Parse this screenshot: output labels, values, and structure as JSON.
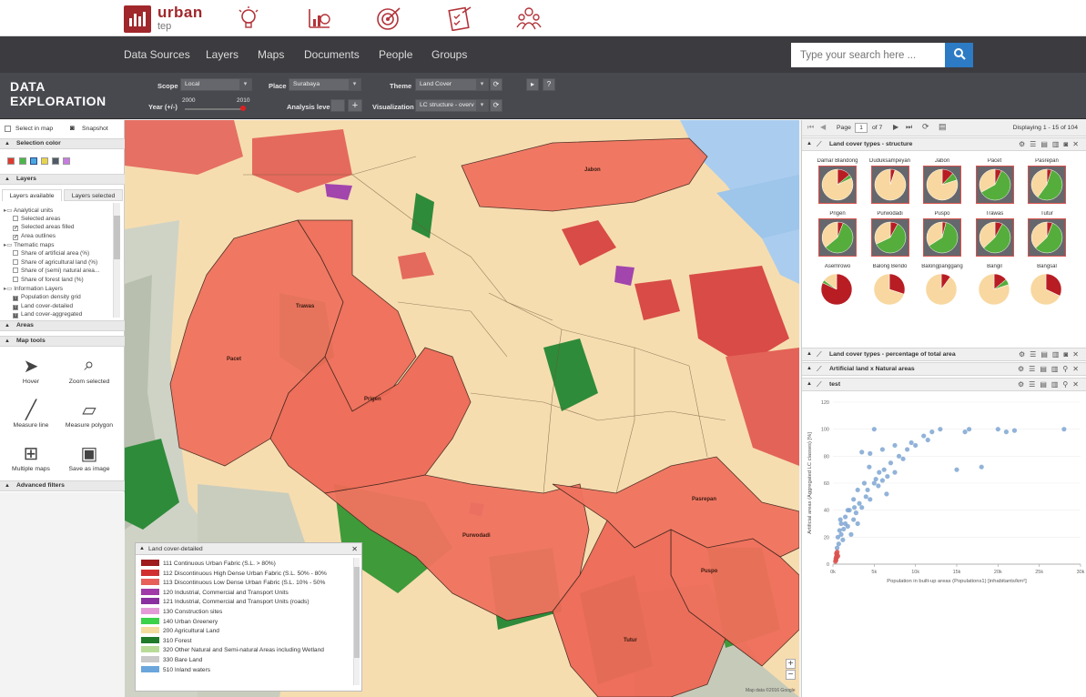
{
  "app": {
    "logo_text": "urban",
    "logo_sub": "tep",
    "brand_color": "#a0272b"
  },
  "top_icons": [
    "lightbulb-icon",
    "chart-icon",
    "target-icon",
    "checklist-icon",
    "people-icon"
  ],
  "nav": {
    "items": [
      "Data Sources",
      "Layers",
      "Maps",
      "Documents",
      "People",
      "Groups"
    ],
    "search_placeholder": "Type your search here ..."
  },
  "explore": {
    "title_line1": "DATA",
    "title_line2": "EXPLORATION",
    "scope_label": "Scope",
    "scope_value": "Local",
    "place_label": "Place",
    "place_value": "Surabaya",
    "theme_label": "Theme",
    "theme_value": "Land Cover",
    "year_label": "Year (+/-)",
    "year_from": "2000",
    "year_to": "2010",
    "analysis_label": "Analysis level",
    "visualization_label": "Visualization",
    "visualization_value": "LC structure - overv"
  },
  "left": {
    "select_in_map": "Select in map",
    "snapshot": "Snapshot",
    "selection_color": "Selection color",
    "colors": [
      "#e03a2f",
      "#4cb74a",
      "#4aa8e0",
      "#e8d44a",
      "#4f5a66",
      "#c77ce0"
    ],
    "layers_title": "Layers",
    "tab_available": "Layers available",
    "tab_selected": "Layers selected",
    "tree": [
      {
        "label": "Analytical units",
        "type": "folder",
        "indent": 0
      },
      {
        "label": "Selected areas",
        "type": "item",
        "indent": 1,
        "checked": false
      },
      {
        "label": "Selected areas filled",
        "type": "item",
        "indent": 1,
        "checked": true
      },
      {
        "label": "Area outlines",
        "type": "item",
        "indent": 1,
        "checked": true
      },
      {
        "label": "Thematic maps",
        "type": "folder",
        "indent": 0
      },
      {
        "label": "Share of artificial area (%)",
        "type": "item",
        "indent": 1,
        "checked": false
      },
      {
        "label": "Share of agricultural land (%)",
        "type": "item",
        "indent": 1,
        "checked": false
      },
      {
        "label": "Share of (semi) natural area...",
        "type": "item",
        "indent": 1,
        "checked": false
      },
      {
        "label": "Share of forest land (%)",
        "type": "item",
        "indent": 1,
        "checked": false
      },
      {
        "label": "Information Layers",
        "type": "folder",
        "indent": 0
      },
      {
        "label": "Population density grid",
        "type": "info",
        "indent": 1,
        "checked": false
      },
      {
        "label": "Land cover-detailed",
        "type": "info",
        "indent": 1,
        "checked": true
      },
      {
        "label": "Land cover-aggregated",
        "type": "info",
        "indent": 1,
        "checked": false
      }
    ],
    "areas_title": "Areas",
    "map_tools_title": "Map tools",
    "tools": [
      "Hover",
      "Zoom selected",
      "Measure line",
      "Measure polygon",
      "Multiple maps",
      "Save as image"
    ],
    "advanced_filters": "Advanced filters"
  },
  "map": {
    "area_labels": [
      "Jabon",
      "Trawas",
      "Pacet",
      "Prigen",
      "Purwodadi",
      "Pasrepan",
      "Puspo",
      "Tutur"
    ],
    "attribution": "Map data ©2016 Google"
  },
  "legend": {
    "title": "Land cover-detailed",
    "items": [
      {
        "code": "111",
        "label": "Continuous Urban Fabric (S.L. > 80%)",
        "color": "#9e1b1e"
      },
      {
        "code": "112",
        "label": "Discontinuous High Dense Urban Fabric (S.L. 50% - 80%",
        "color": "#d12f2f"
      },
      {
        "code": "113",
        "label": "Discontinuous Low Dense Urban Fabric (S.L. 10% - 50%",
        "color": "#e8605a"
      },
      {
        "code": "120",
        "label": "Industrial, Commercial and Transport Units",
        "color": "#a03aa8"
      },
      {
        "code": "121",
        "label": "Industrial, Commercial and Transport Units (roads)",
        "color": "#8a2fa0"
      },
      {
        "code": "130",
        "label": "Construction sites",
        "color": "#e59ad8"
      },
      {
        "code": "140",
        "label": "Urban Greenery",
        "color": "#3bd14a"
      },
      {
        "code": "200",
        "label": "Agricultural Land",
        "color": "#f3dc9e"
      },
      {
        "code": "310",
        "label": "Forest",
        "color": "#1f7a2a"
      },
      {
        "code": "320",
        "label": "Other Natural and Semi-natural Areas including Wetland",
        "color": "#b8dc98"
      },
      {
        "code": "330",
        "label": "Bare Land",
        "color": "#c9c9c9"
      },
      {
        "code": "510",
        "label": "Inland waters",
        "color": "#6aa6dc"
      }
    ]
  },
  "right": {
    "page_label": "Page",
    "page_value": "1",
    "page_of": "of 7",
    "displaying": "Displaying 1 - 15 of 104",
    "panel1_title": "Land cover types - structure",
    "pies": [
      {
        "label": "Damar Blandong",
        "slices": [
          0.14,
          0.04,
          0.82
        ],
        "selected": true
      },
      {
        "label": "Duduksampeyan",
        "slices": [
          0.05,
          0.0,
          0.95
        ],
        "selected": true
      },
      {
        "label": "Jabon",
        "slices": [
          0.12,
          0.08,
          0.8
        ],
        "selected": true
      },
      {
        "label": "Pacet",
        "slices": [
          0.07,
          0.6,
          0.33
        ],
        "selected": true
      },
      {
        "label": "Pasrepan",
        "slices": [
          0.05,
          0.55,
          0.4
        ],
        "selected": true
      },
      {
        "label": "Prigen",
        "slices": [
          0.06,
          0.58,
          0.36
        ],
        "selected": true
      },
      {
        "label": "Purwodadi",
        "slices": [
          0.08,
          0.6,
          0.32
        ],
        "selected": true
      },
      {
        "label": "Puspo",
        "slices": [
          0.04,
          0.62,
          0.34
        ],
        "selected": true
      },
      {
        "label": "Trawas",
        "slices": [
          0.08,
          0.55,
          0.37
        ],
        "selected": true
      },
      {
        "label": "Tutur",
        "slices": [
          0.06,
          0.57,
          0.37
        ],
        "selected": true
      },
      {
        "label": "Asemrowo",
        "slices": [
          0.82,
          0.03,
          0.15
        ],
        "selected": false
      },
      {
        "label": "Balong Bendo",
        "slices": [
          0.3,
          0.0,
          0.7
        ],
        "selected": false
      },
      {
        "label": "Balongpanggang",
        "slices": [
          0.1,
          0.0,
          0.9
        ],
        "selected": false
      },
      {
        "label": "Bangil",
        "slices": [
          0.14,
          0.06,
          0.8
        ],
        "selected": false
      },
      {
        "label": "Bangsal",
        "slices": [
          0.32,
          0.0,
          0.68
        ],
        "selected": false
      }
    ],
    "pie_colors": [
      "#b81d24",
      "#55ad3c",
      "#f8d8a0"
    ],
    "panel2_title": "Land cover types - percentage of total area",
    "panel3_title": "Artificial land x Natural areas",
    "panel4_title": "test"
  },
  "chart_data": {
    "type": "scatter",
    "xlabel": "Population in built-up areas (Populations1) [inhabitants/km²]",
    "ylabel": "Artificial areas (Aggregated LC classes) [%]",
    "xlim": [
      0,
      30000
    ],
    "ylim": [
      0,
      120
    ],
    "x_ticks": [
      "0k",
      "5k",
      "10k",
      "15k",
      "20k",
      "25k",
      "30k"
    ],
    "y_ticks": [
      "0",
      "20",
      "40",
      "60",
      "80",
      "100",
      "120"
    ],
    "series": [
      {
        "color": "#7fa6d2",
        "points": [
          [
            500,
            12
          ],
          [
            600,
            20
          ],
          [
            800,
            25
          ],
          [
            1000,
            30
          ],
          [
            1200,
            18
          ],
          [
            1500,
            35
          ],
          [
            1800,
            28
          ],
          [
            2000,
            40
          ],
          [
            2200,
            22
          ],
          [
            2500,
            33
          ],
          [
            2800,
            38
          ],
          [
            3000,
            30
          ],
          [
            3200,
            45
          ],
          [
            3500,
            42
          ],
          [
            4000,
            50
          ],
          [
            4200,
            55
          ],
          [
            4500,
            48
          ],
          [
            5000,
            60
          ],
          [
            5200,
            63
          ],
          [
            5500,
            58
          ],
          [
            6000,
            62
          ],
          [
            6200,
            70
          ],
          [
            6500,
            52
          ],
          [
            7000,
            75
          ],
          [
            7500,
            68
          ],
          [
            8000,
            80
          ],
          [
            8500,
            78
          ],
          [
            9000,
            85
          ],
          [
            9500,
            90
          ],
          [
            10000,
            88
          ],
          [
            11000,
            95
          ],
          [
            11500,
            92
          ],
          [
            12000,
            98
          ],
          [
            13000,
            100
          ],
          [
            15000,
            70
          ],
          [
            16000,
            98
          ],
          [
            16500,
            100
          ],
          [
            18000,
            72
          ],
          [
            20000,
            100
          ],
          [
            21000,
            98
          ],
          [
            22000,
            99
          ],
          [
            28000,
            100
          ],
          [
            5000,
            100
          ],
          [
            3500,
            83
          ],
          [
            4500,
            82
          ],
          [
            6000,
            85
          ],
          [
            3000,
            55
          ],
          [
            2500,
            48
          ],
          [
            1800,
            40
          ],
          [
            1500,
            30
          ],
          [
            1000,
            22
          ],
          [
            700,
            15
          ],
          [
            900,
            33
          ],
          [
            1300,
            26
          ],
          [
            2600,
            42
          ],
          [
            3800,
            60
          ],
          [
            4400,
            72
          ],
          [
            5600,
            68
          ],
          [
            6600,
            65
          ],
          [
            7500,
            88
          ]
        ]
      },
      {
        "color": "#d9534f",
        "points": [
          [
            300,
            2
          ],
          [
            350,
            4
          ],
          [
            400,
            5
          ],
          [
            450,
            6
          ],
          [
            500,
            7
          ],
          [
            380,
            3
          ],
          [
            420,
            8
          ],
          [
            460,
            5
          ],
          [
            520,
            9
          ],
          [
            600,
            6
          ]
        ]
      }
    ]
  }
}
